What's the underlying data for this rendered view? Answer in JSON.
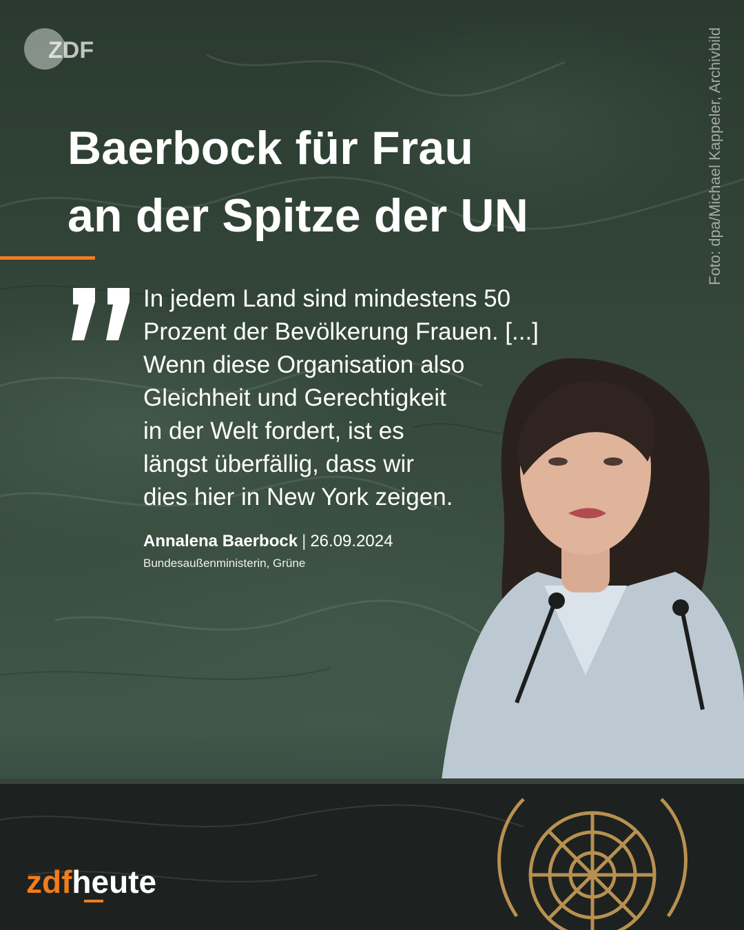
{
  "brand": {
    "logo_top": "ZDF",
    "logo_bottom_prefix": "zdf",
    "logo_bottom_suffix": "heute"
  },
  "credit": "Foto: dpa/Michael Kappeler, Archivbild",
  "headline": {
    "line1": "Baerbock für Frau",
    "line2": "an der Spitze der UN"
  },
  "quote": {
    "lines": [
      "In jedem Land sind mindestens 50",
      "Prozent der Bevölkerung Frauen. [...]",
      "Wenn diese Organisation also",
      "Gleichheit und Gerechtigkeit",
      "in der Welt fordert, ist es",
      "längst überfällig, dass wir",
      "dies hier in New York zeigen."
    ],
    "author": "Annalena Baerbock",
    "separator": "|",
    "date": "26.09.2024",
    "role": "Bundesaußenministerin, Grüne"
  },
  "colors": {
    "accent": "#f07d1e",
    "text": "#ffffff",
    "background": "#34463a"
  },
  "icons": {
    "logo": "zdf-logo-icon",
    "quote": "quote-mark-icon",
    "emblem": "un-emblem-icon"
  }
}
